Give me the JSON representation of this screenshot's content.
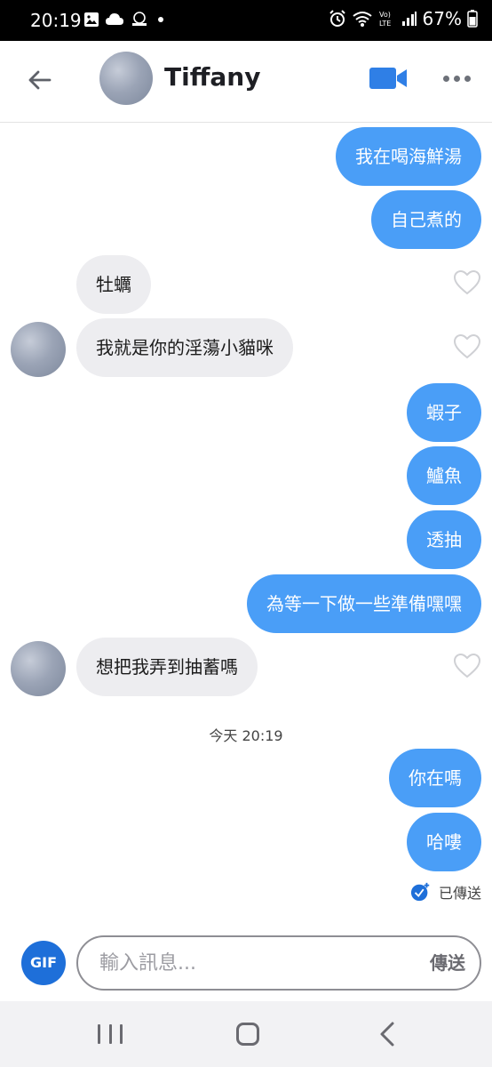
{
  "status_bar": {
    "time": "20:19",
    "battery": "67%",
    "left_icons": [
      "image-icon",
      "cloud-icon",
      "app-icon",
      "dot-icon"
    ],
    "right_icons": [
      "alarm-icon",
      "wifi-icon",
      "volte-icon",
      "signal-icon",
      "battery-icon"
    ]
  },
  "header": {
    "name": "Tiffany",
    "back_icon": "back-arrow-icon",
    "video_icon": "video-camera-icon",
    "more_icon": "more-dots-icon",
    "accent": "#2f7fe6"
  },
  "messages": [
    {
      "dir": "out",
      "text": "我在喝海鮮湯"
    },
    {
      "dir": "out",
      "text": "自己煮的"
    },
    {
      "dir": "in",
      "text": "牡蠣",
      "avatar": false,
      "liked": false
    },
    {
      "dir": "in",
      "text": "我就是你的淫蕩小貓咪",
      "avatar": true,
      "liked": false
    },
    {
      "dir": "out",
      "text": "蝦子"
    },
    {
      "dir": "out",
      "text": "鱸魚"
    },
    {
      "dir": "out",
      "text": "透抽"
    },
    {
      "dir": "out",
      "text": "為等一下做一些準備嘿嘿"
    },
    {
      "dir": "in",
      "text": "想把我弄到抽蓄嗎",
      "avatar": true,
      "liked": false
    },
    {
      "dir": "out",
      "text": "你在嗎"
    },
    {
      "dir": "out",
      "text": "哈嘍"
    }
  ],
  "timestamp": "今天 20:19",
  "sent_status": "已傳送",
  "composer": {
    "gif_label": "GIF",
    "placeholder": "輸入訊息...",
    "send_label": "傳送"
  },
  "colors": {
    "outgoing_bubble": "#4a9ef7",
    "incoming_bubble": "#ededf0",
    "gif_button": "#1e6fd9"
  },
  "nav": [
    "recents-icon",
    "home-icon",
    "back-icon"
  ]
}
